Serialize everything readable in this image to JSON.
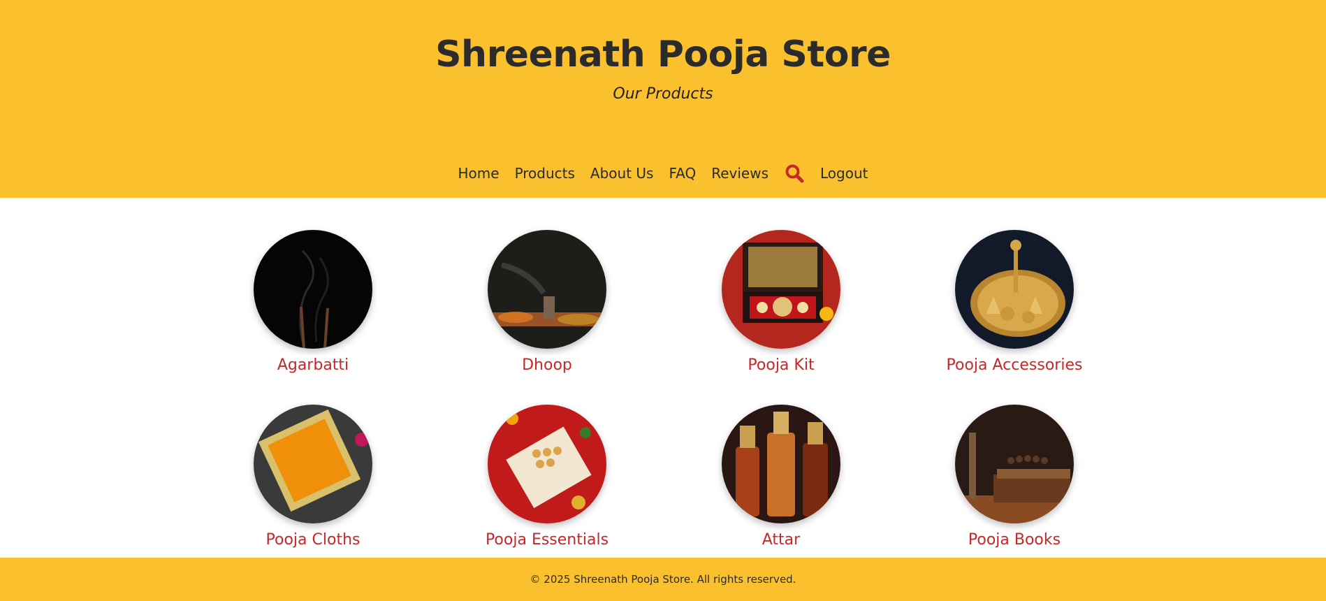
{
  "header": {
    "title": "Shreenath Pooja Store",
    "subtitle": "Our Products"
  },
  "nav": {
    "items": [
      {
        "label": "Home"
      },
      {
        "label": "Products"
      },
      {
        "label": "About Us"
      },
      {
        "label": "FAQ"
      },
      {
        "label": "Reviews"
      }
    ],
    "search_icon": "search-icon",
    "logout_label": "Logout"
  },
  "products": [
    {
      "name": "Agarbatti"
    },
    {
      "name": "Dhoop"
    },
    {
      "name": "Pooja Kit"
    },
    {
      "name": "Pooja Accessories"
    },
    {
      "name": "Pooja Cloths"
    },
    {
      "name": "Pooja Essentials"
    },
    {
      "name": "Attar"
    },
    {
      "name": "Pooja Books"
    }
  ],
  "footer": {
    "text": "© 2025 Shreenath Pooja Store. All rights reserved."
  },
  "colors": {
    "brand_yellow": "#fbc02d",
    "accent_red": "#c62828",
    "text_dark": "#2b2b2b"
  }
}
